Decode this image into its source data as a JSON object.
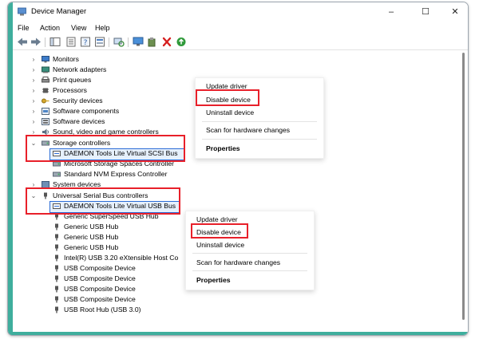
{
  "window": {
    "title": "Device Manager"
  },
  "menu": [
    "File",
    "Action",
    "View",
    "Help"
  ],
  "tree": {
    "collapsed_top": [
      "Monitors",
      "Network adapters",
      "Print queues",
      "Processors",
      "Security devices",
      "Software components",
      "Software devices",
      "Sound, video and game controllers"
    ],
    "storage": {
      "label": "Storage controllers",
      "children": [
        "DAEMON Tools Lite Virtual SCSI Bus",
        "Microsoft Storage Spaces Controller",
        "Standard NVM Express Controller"
      ]
    },
    "system": "System devices",
    "usb": {
      "label": "Universal Serial Bus controllers",
      "children": [
        "DAEMON Tools Lite Virtual USB Bus",
        "Generic SuperSpeed USB Hub",
        "Generic USB Hub",
        "Generic USB Hub",
        "Generic USB Hub",
        "Intel(R) USB 3.20 eXtensible Host Co",
        "USB Composite Device",
        "USB Composite Device",
        "USB Composite Device",
        "USB Composite Device",
        "USB Root Hub (USB 3.0)"
      ]
    }
  },
  "context_menu_1": {
    "update": "Update driver",
    "disable": "Disable device",
    "uninstall": "Uninstall device",
    "scan": "Scan for hardware changes",
    "properties": "Properties"
  },
  "context_menu_2": {
    "update": "Update driver",
    "disable": "Disable device",
    "uninstall": "Uninstall device",
    "scan": "Scan for hardware changes",
    "properties": "Properties"
  },
  "colors": {
    "accent_frame": "#3fae9d",
    "highlight_red": "#e8202a",
    "selection": "#2a6bd6"
  }
}
